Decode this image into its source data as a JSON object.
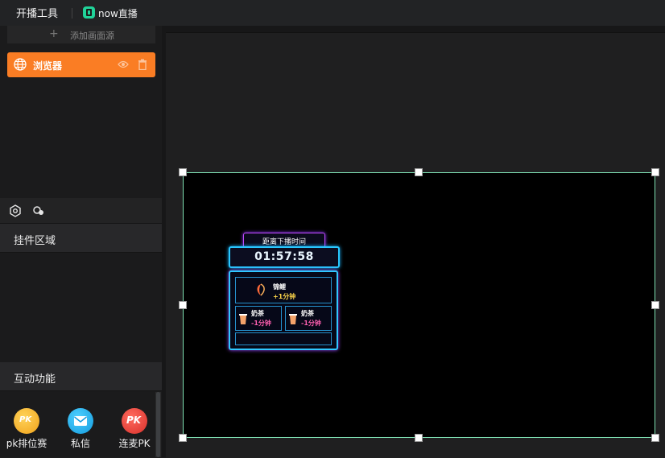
{
  "topbar": {
    "app_title": "开播工具",
    "brand": "now直播"
  },
  "sources": {
    "add_label": "添加画面源",
    "items": [
      {
        "label": "浏览器"
      }
    ]
  },
  "sections": {
    "widgets_title": "挂件区域",
    "interactive_title": "互动功能"
  },
  "features": [
    {
      "label": "pk排位赛",
      "icon": "pk-rank-icon",
      "color": "#f5a623"
    },
    {
      "label": "私信",
      "icon": "mail-icon",
      "color": "#1aa7e8"
    },
    {
      "label": "连麦PK",
      "icon": "pk-icon",
      "color": "#e8403c"
    }
  ],
  "overlay_widget": {
    "header": "距离下播时间",
    "timer": "01:57:58",
    "main_gift": {
      "name": "锦鲤",
      "value": "+1分钟"
    },
    "gifts": [
      {
        "name": "奶茶",
        "value": "-1分钟"
      },
      {
        "name": "奶茶",
        "value": "-1分钟"
      }
    ]
  },
  "colors": {
    "accent": "#fa7d24",
    "selection": "#7fe0b4",
    "brand": "#21d39a"
  }
}
